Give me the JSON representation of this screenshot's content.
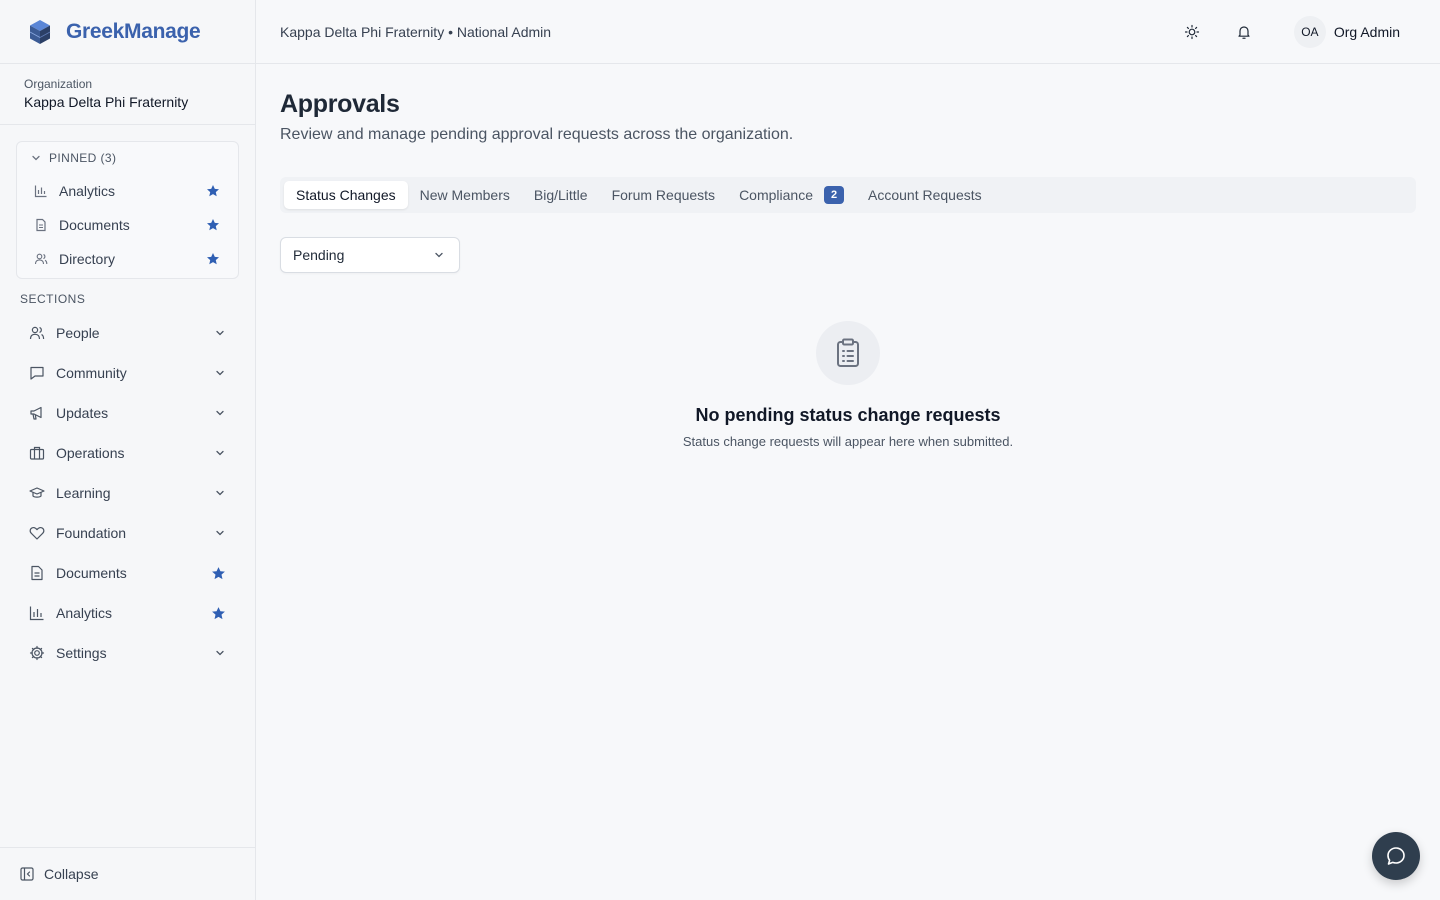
{
  "brand": {
    "name": "GreekManage"
  },
  "org": {
    "label": "Organization",
    "name": "Kappa Delta Phi Fraternity"
  },
  "pinned": {
    "header": "PINNED (3)",
    "items": [
      {
        "label": "Analytics",
        "icon": "bar-chart-icon"
      },
      {
        "label": "Documents",
        "icon": "document-icon"
      },
      {
        "label": "Directory",
        "icon": "users-icon"
      }
    ]
  },
  "sections": {
    "label": "SECTIONS",
    "items": [
      {
        "label": "People",
        "icon": "users-icon",
        "trail": "chevron"
      },
      {
        "label": "Community",
        "icon": "message-icon",
        "trail": "chevron"
      },
      {
        "label": "Updates",
        "icon": "megaphone-icon",
        "trail": "chevron"
      },
      {
        "label": "Operations",
        "icon": "building-icon",
        "trail": "chevron"
      },
      {
        "label": "Learning",
        "icon": "graduation-cap-icon",
        "trail": "chevron"
      },
      {
        "label": "Foundation",
        "icon": "heart-icon",
        "trail": "chevron"
      },
      {
        "label": "Documents",
        "icon": "document-icon",
        "trail": "star"
      },
      {
        "label": "Analytics",
        "icon": "bar-chart-icon",
        "trail": "star"
      },
      {
        "label": "Settings",
        "icon": "gear-icon",
        "trail": "chevron"
      }
    ]
  },
  "collapse": {
    "label": "Collapse"
  },
  "header": {
    "breadcrumb": "Kappa Delta Phi Fraternity • National Admin",
    "user": {
      "initials": "OA",
      "name": "Org Admin"
    }
  },
  "page": {
    "title": "Approvals",
    "subtitle": "Review and manage pending approval requests across the organization."
  },
  "tabs": [
    {
      "label": "Status Changes",
      "active": true
    },
    {
      "label": "New Members"
    },
    {
      "label": "Big/Little"
    },
    {
      "label": "Forum Requests"
    },
    {
      "label": "Compliance",
      "badge": "2"
    },
    {
      "label": "Account Requests"
    }
  ],
  "filter": {
    "value": "Pending"
  },
  "empty": {
    "title": "No pending status change requests",
    "subtitle": "Status change requests will appear here when submitted."
  },
  "colors": {
    "accent": "#3b62ad",
    "fab": "#2f3e4e"
  }
}
